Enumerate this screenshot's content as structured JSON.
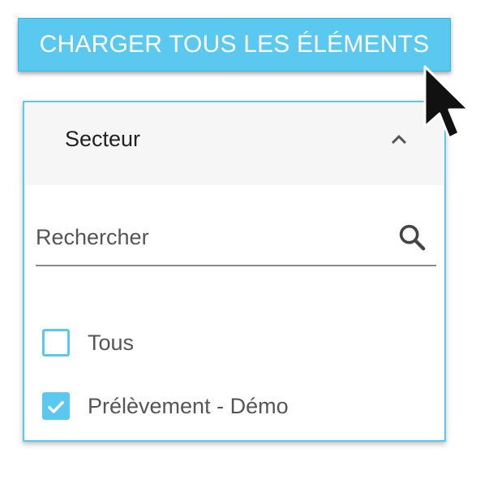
{
  "toolbar": {
    "load_all_label": "CHARGER TOUS LES ÉLÉMENTS"
  },
  "panel": {
    "title": "Secteur",
    "expanded": true,
    "search": {
      "placeholder": "Rechercher",
      "value": ""
    },
    "options": [
      {
        "label": "Tous",
        "checked": false
      },
      {
        "label": "Prélèvement - Démo",
        "checked": true
      }
    ]
  },
  "colors": {
    "accent": "#5bc8ef",
    "header_bg": "#f6f6f6",
    "text_dark": "#212121",
    "text_muted": "#555555"
  },
  "icons": {
    "collapse": "chevron-up-icon",
    "search": "search-icon",
    "check": "check-icon",
    "pointer": "mouse-pointer-icon"
  }
}
